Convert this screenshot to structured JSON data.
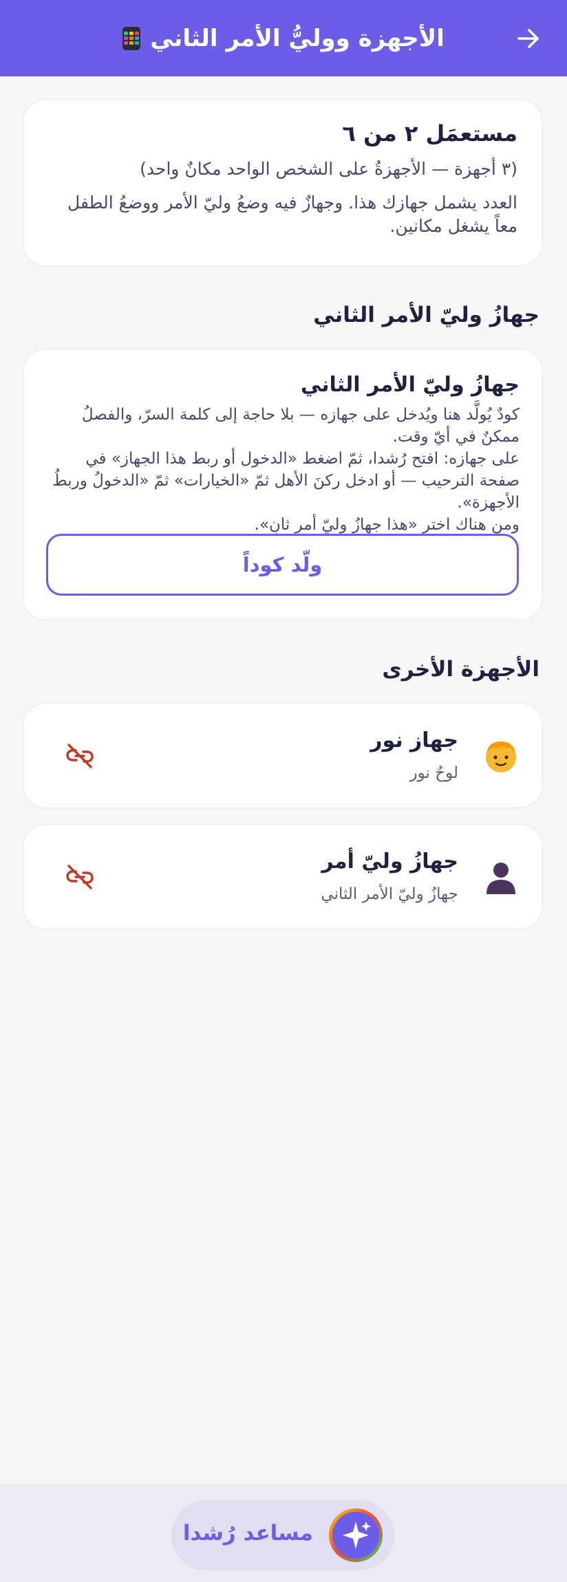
{
  "header": {
    "title": "الأجهزة ووليُّ الأمر الثاني",
    "back_icon": "arrow-right-icon",
    "title_icon": "phone-grid-icon",
    "background_color": "#6c5ce7"
  },
  "usage": {
    "title": "مستعمَل ٢ من ٦",
    "subtitle": "(٣ أجهزة — الأجهزةُ على الشخص الواحد مكانٌ واحد)",
    "description": "العدد يشمل جهازك هذا. وجهازٌ فيه وضعُ وليّ الأمر ووضعُ الطفل معاً يشغل مكانين."
  },
  "pairing": {
    "section_title": "جهازُ وليّ الأمر الثاني",
    "card_title": "جهازُ وليّ الأمر الثاني",
    "line1": "كودٌ يُولَّد هنا ويُدخل على جهازه — بلا حاجة إلى كلمة السرّ، والفصلُ ممكنٌ في أيّ وقت.",
    "line2": "على جهازه: افتح رُشدا، ثمّ اضغط «الدخول أو ربط هذا الجهاز» في صفحة الترحيب — أو ادخل ركنَ الأهل ثمّ «الخيارات» ثمّ «الدخولُ وربطُ الأجهزة».",
    "line3": "ومن هناك اختر «هذا جهازُ وليّ أمرٍ ثانٍ».",
    "button_label": "ولّد كوداً"
  },
  "other_devices": {
    "section_title": "الأجهزة الأخرى",
    "items": [
      {
        "name": "جهاز نور",
        "subtitle": "لوحُ نور",
        "avatar_icon": "child-face-icon",
        "action_icon": "unlink-icon"
      },
      {
        "name": "جهازُ وليّ أمر",
        "subtitle": "جهازُ وليّ الأمر الثاني",
        "avatar_icon": "parent-silhouette-icon",
        "action_icon": "unlink-icon"
      }
    ]
  },
  "assistant": {
    "label": "مساعد رُشدا",
    "icon": "sparkles-icon"
  },
  "colors": {
    "accent": "#6c5ce7",
    "danger": "#c0392b",
    "text_dark": "#1f2140"
  }
}
